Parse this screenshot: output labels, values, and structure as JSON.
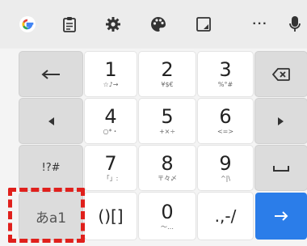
{
  "toolbar": {
    "icons": [
      "google-g-icon",
      "clipboard-icon",
      "settings-gear-icon",
      "palette-icon",
      "resize-icon",
      "more-icon",
      "mic-icon"
    ],
    "more_label": "···"
  },
  "keys": {
    "k1": {
      "main": "1",
      "sub": "☆♪→"
    },
    "k2": {
      "main": "2",
      "sub": "¥$€"
    },
    "k3": {
      "main": "3",
      "sub": "%°#"
    },
    "k4": {
      "main": "4",
      "sub": "○*・"
    },
    "k5": {
      "main": "5",
      "sub": "+×÷"
    },
    "k6": {
      "main": "6",
      "sub": "<=>"
    },
    "k7": {
      "main": "7",
      "sub": "「」:"
    },
    "k8": {
      "main": "8",
      "sub": "〒々〆"
    },
    "k9": {
      "main": "9",
      "sub": "^|\\"
    },
    "k0": {
      "main": "0",
      "sub": "〜…"
    },
    "brackets": "()[]",
    "punct": ".,-/",
    "symbols": "!?#",
    "mode": "あa1"
  },
  "colors": {
    "accent": "#2b7de9",
    "highlight": "#e0201c"
  }
}
